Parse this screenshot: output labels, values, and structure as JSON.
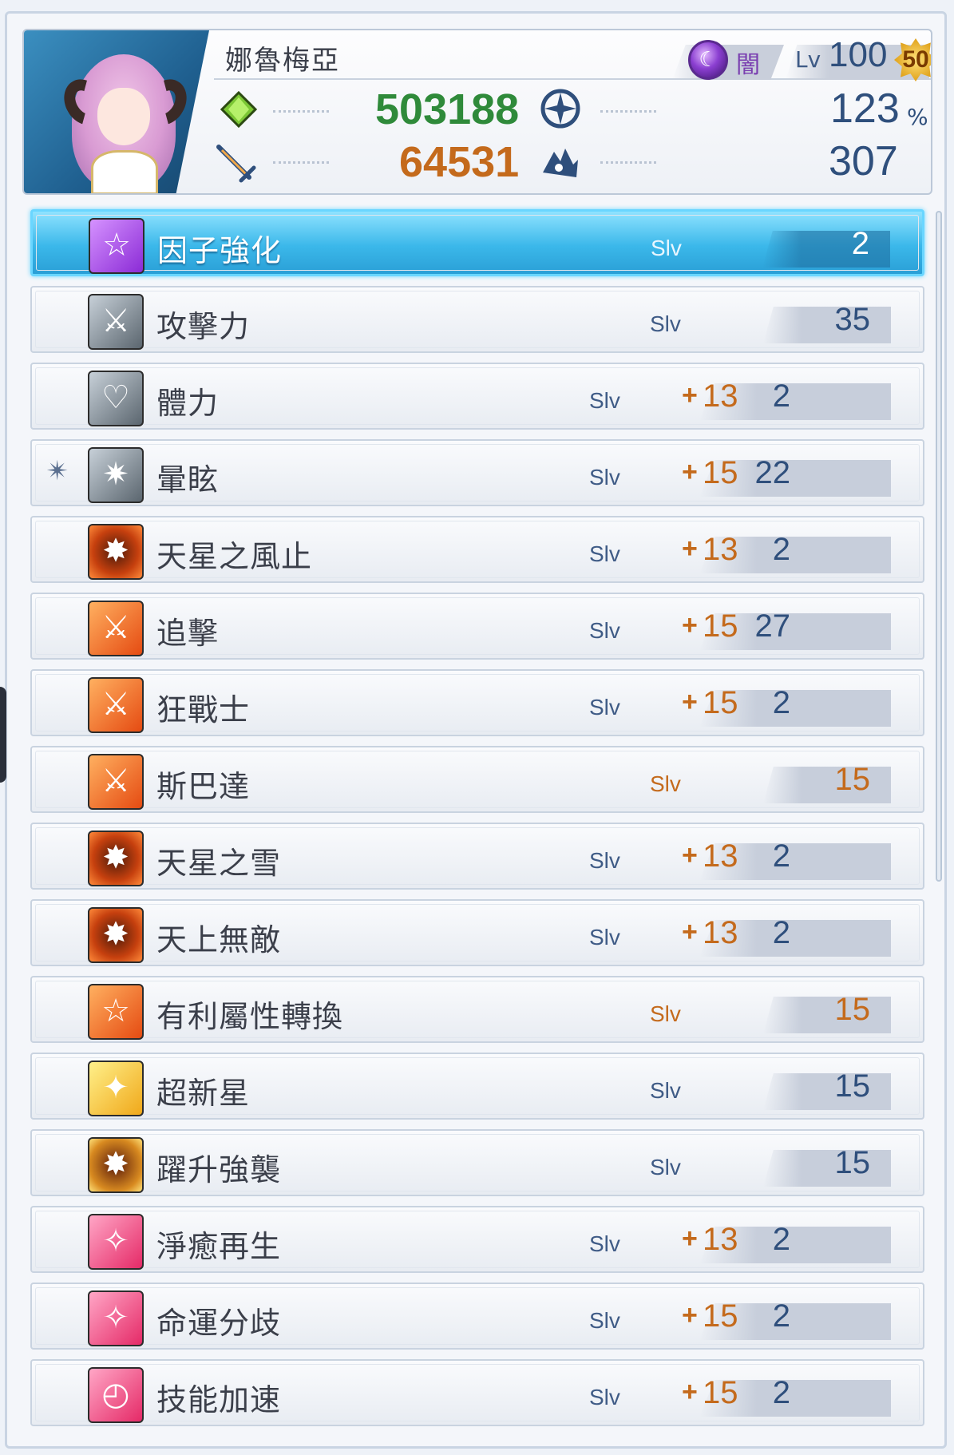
{
  "character": {
    "name": "娜魯梅亞",
    "element": "闇",
    "level_label": "Lv",
    "level": "100",
    "badge": "50"
  },
  "stats": {
    "hp": "503188",
    "atk": "64531",
    "crit": "123",
    "crit_unit": "%",
    "stun": "307"
  },
  "colors": {
    "hp": "#2f8a3a",
    "atk": "#c46a1c",
    "selected": "#3bb8ea"
  },
  "skills": [
    {
      "name": "因子強化",
      "icon": "star-icon",
      "icon_style": "purple",
      "slv_label": "Slv",
      "base": "2",
      "plus": "",
      "bonus": "",
      "selected": true
    },
    {
      "name": "攻擊力",
      "icon": "sword-icon",
      "icon_style": "gray",
      "slv_label": "Slv",
      "base": "35",
      "plus": "",
      "bonus": ""
    },
    {
      "name": "體力",
      "icon": "heart-icon",
      "icon_style": "gray",
      "slv_label": "Slv",
      "base": "2",
      "plus": "+",
      "bonus": "13"
    },
    {
      "name": "暈眩",
      "icon": "stun-icon",
      "icon_style": "gray",
      "slv_label": "Slv",
      "base": "22",
      "plus": "+",
      "bonus": "15",
      "side_icon": "stun-mark-icon"
    },
    {
      "name": "天星之風止",
      "icon": "burst-sword-icon",
      "icon_style": "darkorange",
      "slv_label": "Slv",
      "base": "2",
      "plus": "+",
      "bonus": "13"
    },
    {
      "name": "追擊",
      "icon": "sword-icon",
      "icon_style": "orange",
      "slv_label": "Slv",
      "base": "27",
      "plus": "+",
      "bonus": "15"
    },
    {
      "name": "狂戰士",
      "icon": "sword-icon",
      "icon_style": "orange",
      "slv_label": "Slv",
      "base": "2",
      "plus": "+",
      "bonus": "15"
    },
    {
      "name": "斯巴達",
      "icon": "sword-icon",
      "icon_style": "orange",
      "slv_label": "Slv",
      "base": "15",
      "plus": "",
      "bonus": "",
      "orange_value": true
    },
    {
      "name": "天星之雪",
      "icon": "burst-sword-icon",
      "icon_style": "darkorange",
      "slv_label": "Slv",
      "base": "2",
      "plus": "+",
      "bonus": "13"
    },
    {
      "name": "天上無敵",
      "icon": "burst-sword-icon",
      "icon_style": "darkorange",
      "slv_label": "Slv",
      "base": "2",
      "plus": "+",
      "bonus": "13"
    },
    {
      "name": "有利屬性轉換",
      "icon": "star-icon",
      "icon_style": "orange",
      "slv_label": "Slv",
      "base": "15",
      "plus": "",
      "bonus": "",
      "orange_value": true
    },
    {
      "name": "超新星",
      "icon": "supernova-icon",
      "icon_style": "gold",
      "slv_label": "Slv",
      "base": "15",
      "plus": "",
      "bonus": ""
    },
    {
      "name": "躍升強襲",
      "icon": "burst-sword-icon",
      "icon_style": "goldred",
      "slv_label": "Slv",
      "base": "15",
      "plus": "",
      "bonus": ""
    },
    {
      "name": "淨癒再生",
      "icon": "sparkle-icon",
      "icon_style": "pink",
      "slv_label": "Slv",
      "base": "2",
      "plus": "+",
      "bonus": "13"
    },
    {
      "name": "命運分歧",
      "icon": "sparkle-icon",
      "icon_style": "pink",
      "slv_label": "Slv",
      "base": "2",
      "plus": "+",
      "bonus": "15"
    },
    {
      "name": "技能加速",
      "icon": "clock-icon",
      "icon_style": "pink",
      "slv_label": "Slv",
      "base": "2",
      "plus": "+",
      "bonus": "15"
    }
  ]
}
